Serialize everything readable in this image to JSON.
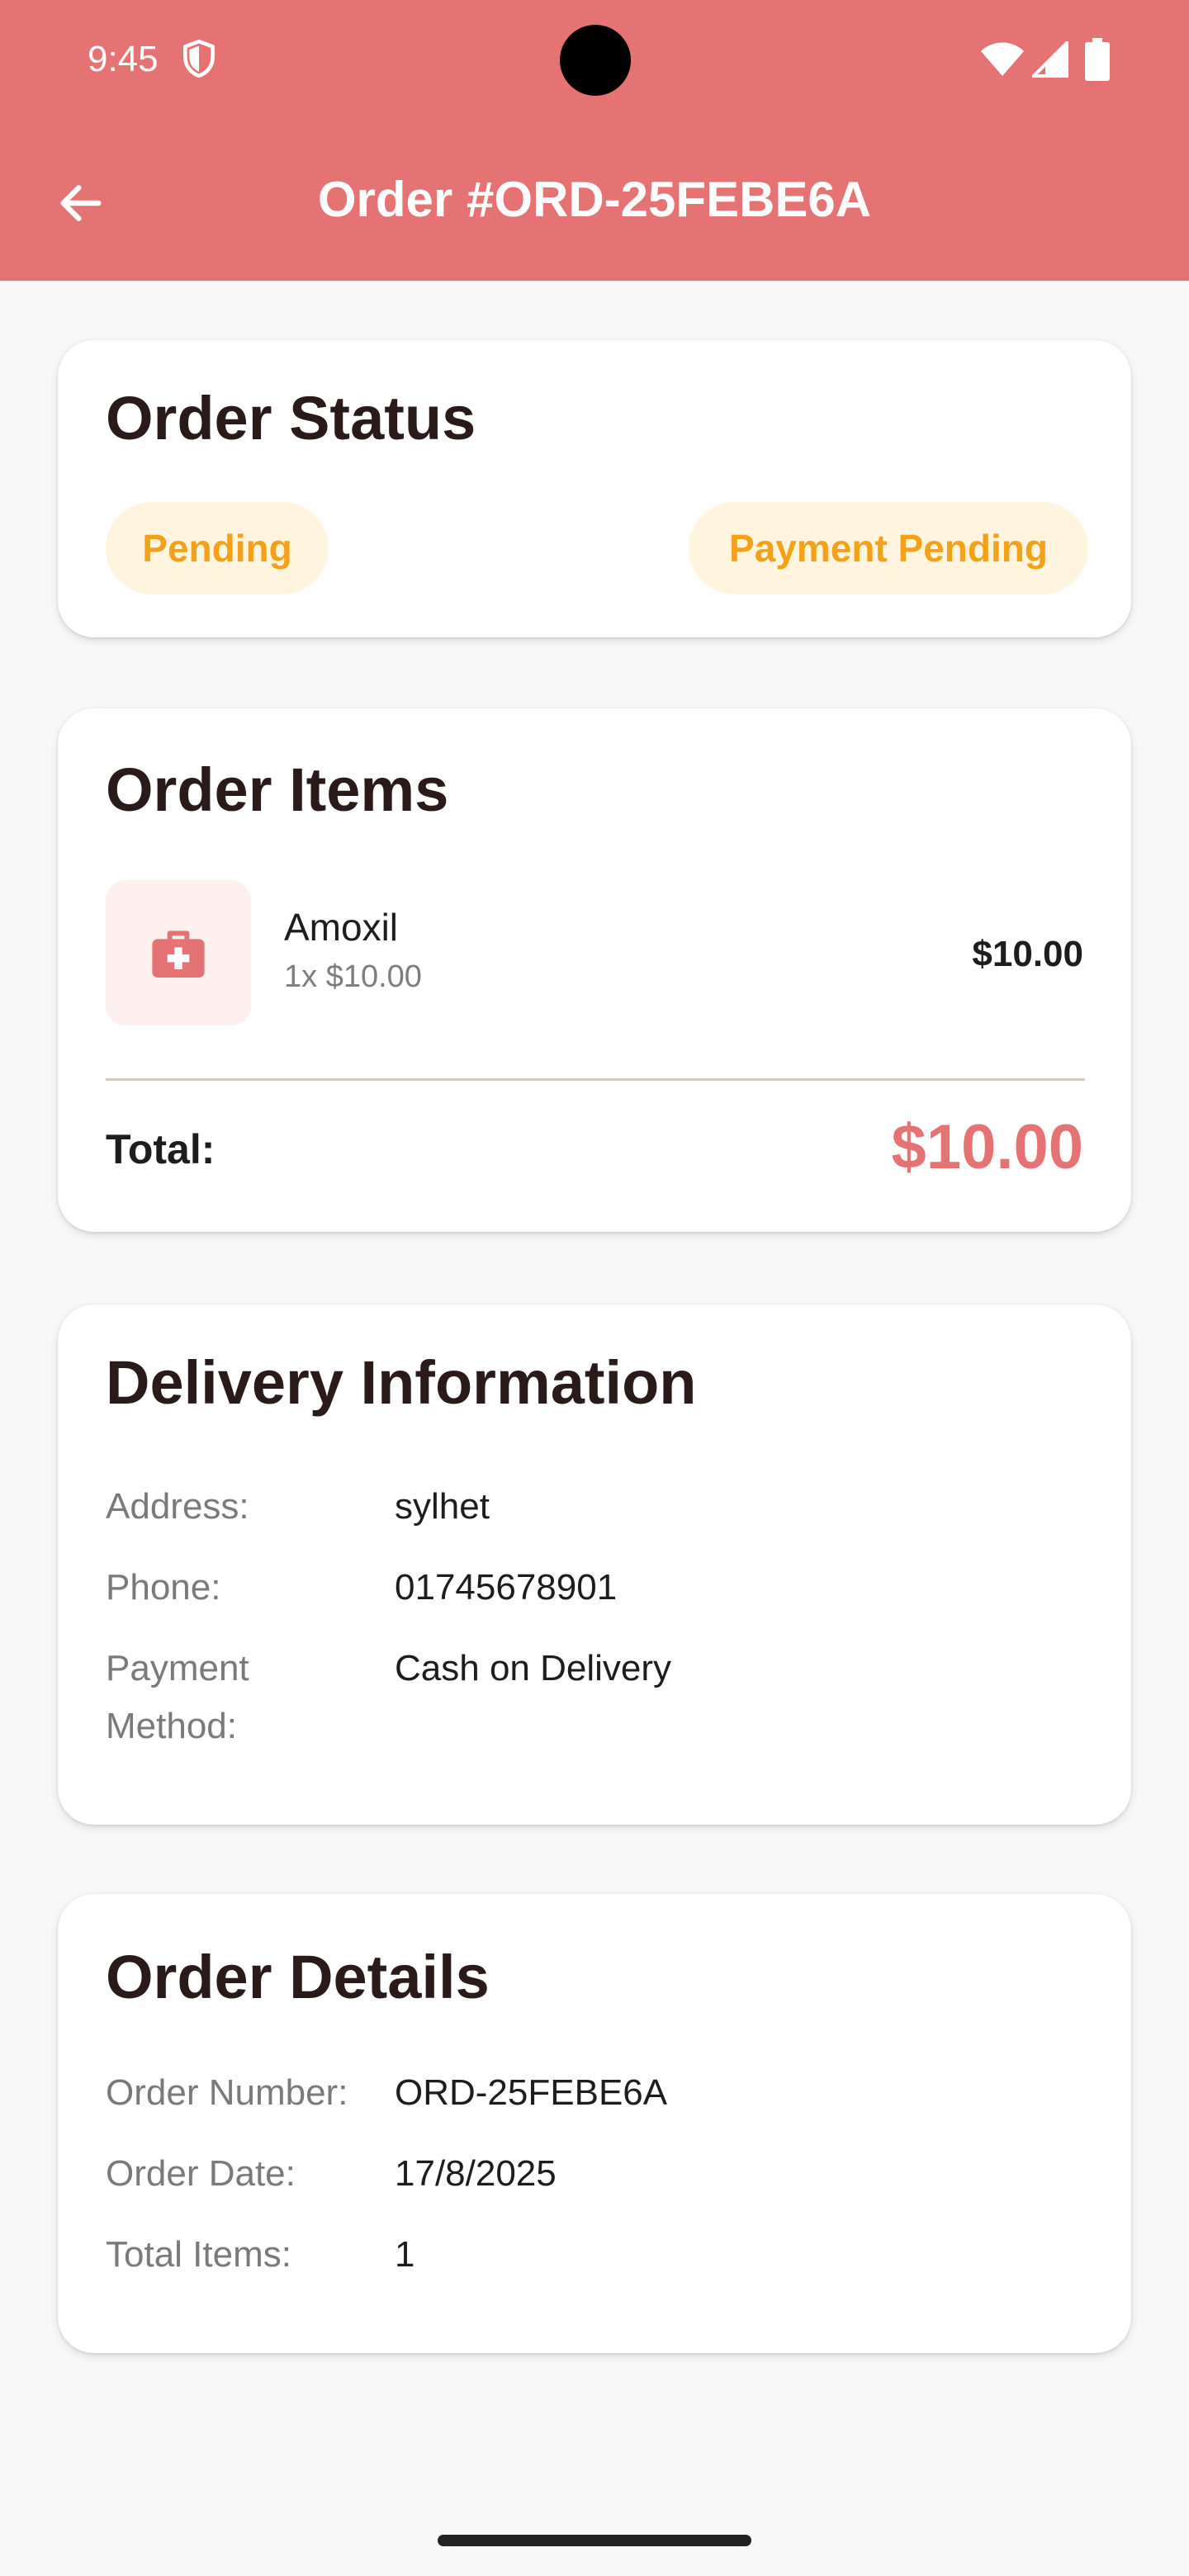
{
  "status_bar": {
    "time": "9:45",
    "icons": [
      "shield-icon",
      "wifi-icon",
      "signal-icon",
      "battery-icon"
    ]
  },
  "app_bar": {
    "title": "Order #ORD-25FEBE6A",
    "back_icon": "arrow-back-icon",
    "background": "#e57373"
  },
  "order_status": {
    "title": "Order Status",
    "status_chip": "Pending",
    "payment_chip": "Payment Pending",
    "chip_color": "#f4a11a"
  },
  "order_items": {
    "title": "Order Items",
    "items": [
      {
        "name": "Amoxil",
        "detail": "1x $10.00",
        "price": "$10.00",
        "icon": "medical-kit-icon"
      }
    ],
    "total_label": "Total:",
    "total_value": "$10.00"
  },
  "delivery": {
    "title": "Delivery Information",
    "address_label": "Address:",
    "address_value": "sylhet",
    "phone_label": "Phone:",
    "phone_value": "01745678901",
    "payment_label": "Payment Method:",
    "payment_value": "Cash on Delivery"
  },
  "details": {
    "title": "Order Details",
    "order_number_label": "Order Number:",
    "order_number_value": "ORD-25FEBE6A",
    "order_date_label": "Order Date:",
    "order_date_value": "17/8/2025",
    "total_items_label": "Total Items:",
    "total_items_value": "1"
  }
}
